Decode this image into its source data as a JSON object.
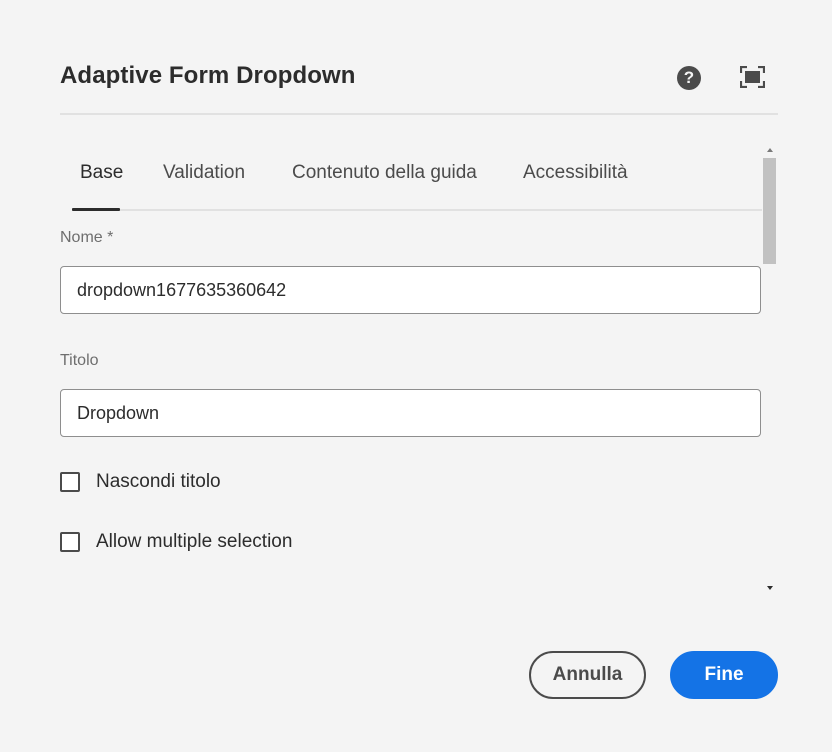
{
  "dialog": {
    "title": "Adaptive Form Dropdown",
    "help_icon": "help-icon",
    "help_glyph": "?",
    "fullscreen_icon": "fullscreen-icon"
  },
  "tabs": [
    {
      "label": "Base",
      "active": true
    },
    {
      "label": "Validation",
      "active": false
    },
    {
      "label": "Contenuto della guida",
      "active": false
    },
    {
      "label": "Accessibilità",
      "active": false
    }
  ],
  "form": {
    "name_label": "Nome *",
    "name_value": "dropdown1677635360642",
    "title_label": "Titolo",
    "title_value": "Dropdown",
    "hide_title_label": "Nascondi titolo",
    "hide_title_checked": false,
    "multi_select_label": "Allow multiple selection",
    "multi_select_checked": false
  },
  "footer": {
    "cancel_label": "Annulla",
    "done_label": "Fine"
  },
  "colors": {
    "accent": "#1473e6",
    "background": "#f4f4f4",
    "text": "#2c2c2c"
  }
}
